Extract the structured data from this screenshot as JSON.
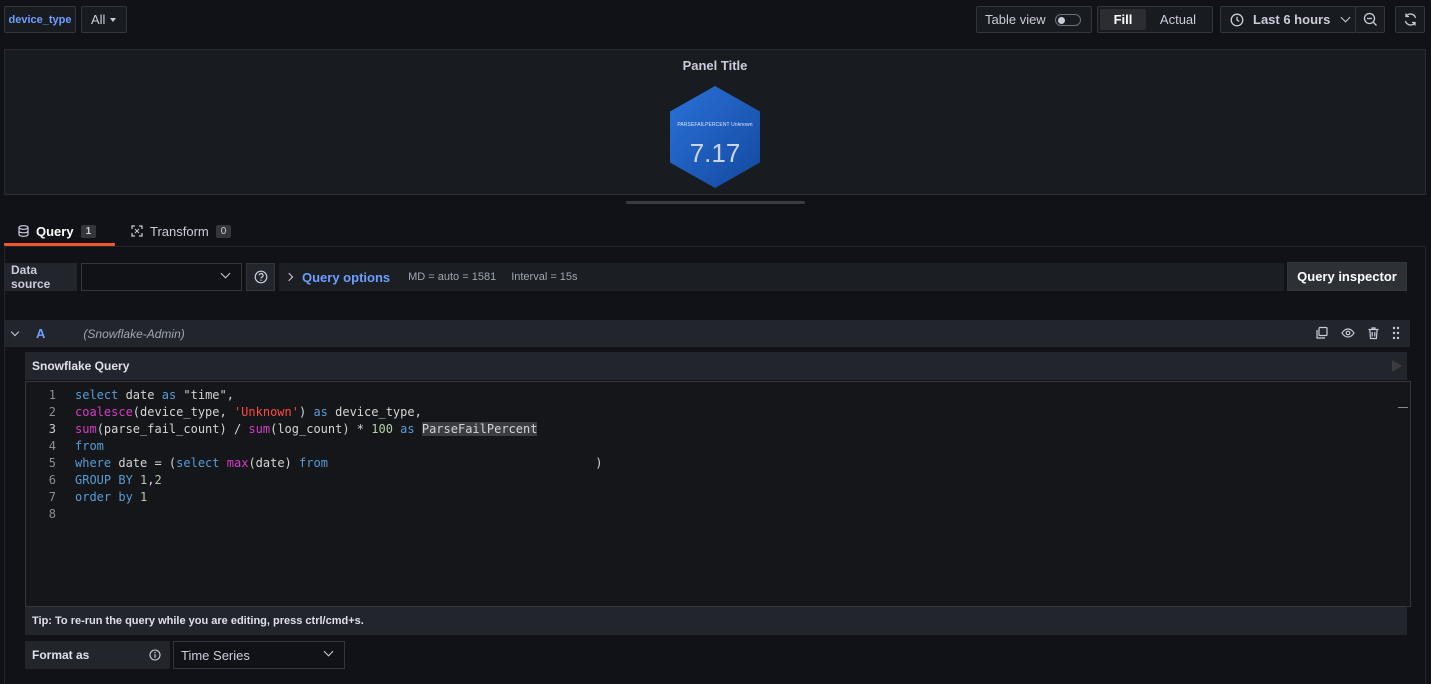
{
  "variables": {
    "label": "device_type",
    "value": "All"
  },
  "toolbar": {
    "table_view_label": "Table view",
    "fill_label": "Fill",
    "actual_label": "Actual",
    "time_range": "Last 6 hours"
  },
  "panel": {
    "title": "Panel Title",
    "stat_label": "PARSEFAILPERCENT Unknown",
    "stat_value": "7.17",
    "hex_color": "#1f60c4"
  },
  "tabs": [
    {
      "label": "Query",
      "count": "1"
    },
    {
      "label": "Transform",
      "count": "0"
    }
  ],
  "datasource": {
    "label": "Data source",
    "selected": "",
    "query_options_label": "Query options",
    "md": "MD = auto = 1581",
    "interval": "Interval = 15s",
    "inspector_label": "Query inspector"
  },
  "query": {
    "ref_id": "A",
    "datasource_name": "(Snowflake-Admin)",
    "editor_title": "Snowflake Query",
    "line_numbers": [
      "1",
      "2",
      "3",
      "4",
      "5",
      "6",
      "7",
      "8"
    ],
    "tip": "Tip: To re-run the query while you are editing, press ctrl/cmd+s.",
    "format_label": "Format as",
    "format_value": "Time Series"
  },
  "colors": {
    "accent_orange": "#f05a28",
    "link_blue": "#6e9fff"
  }
}
